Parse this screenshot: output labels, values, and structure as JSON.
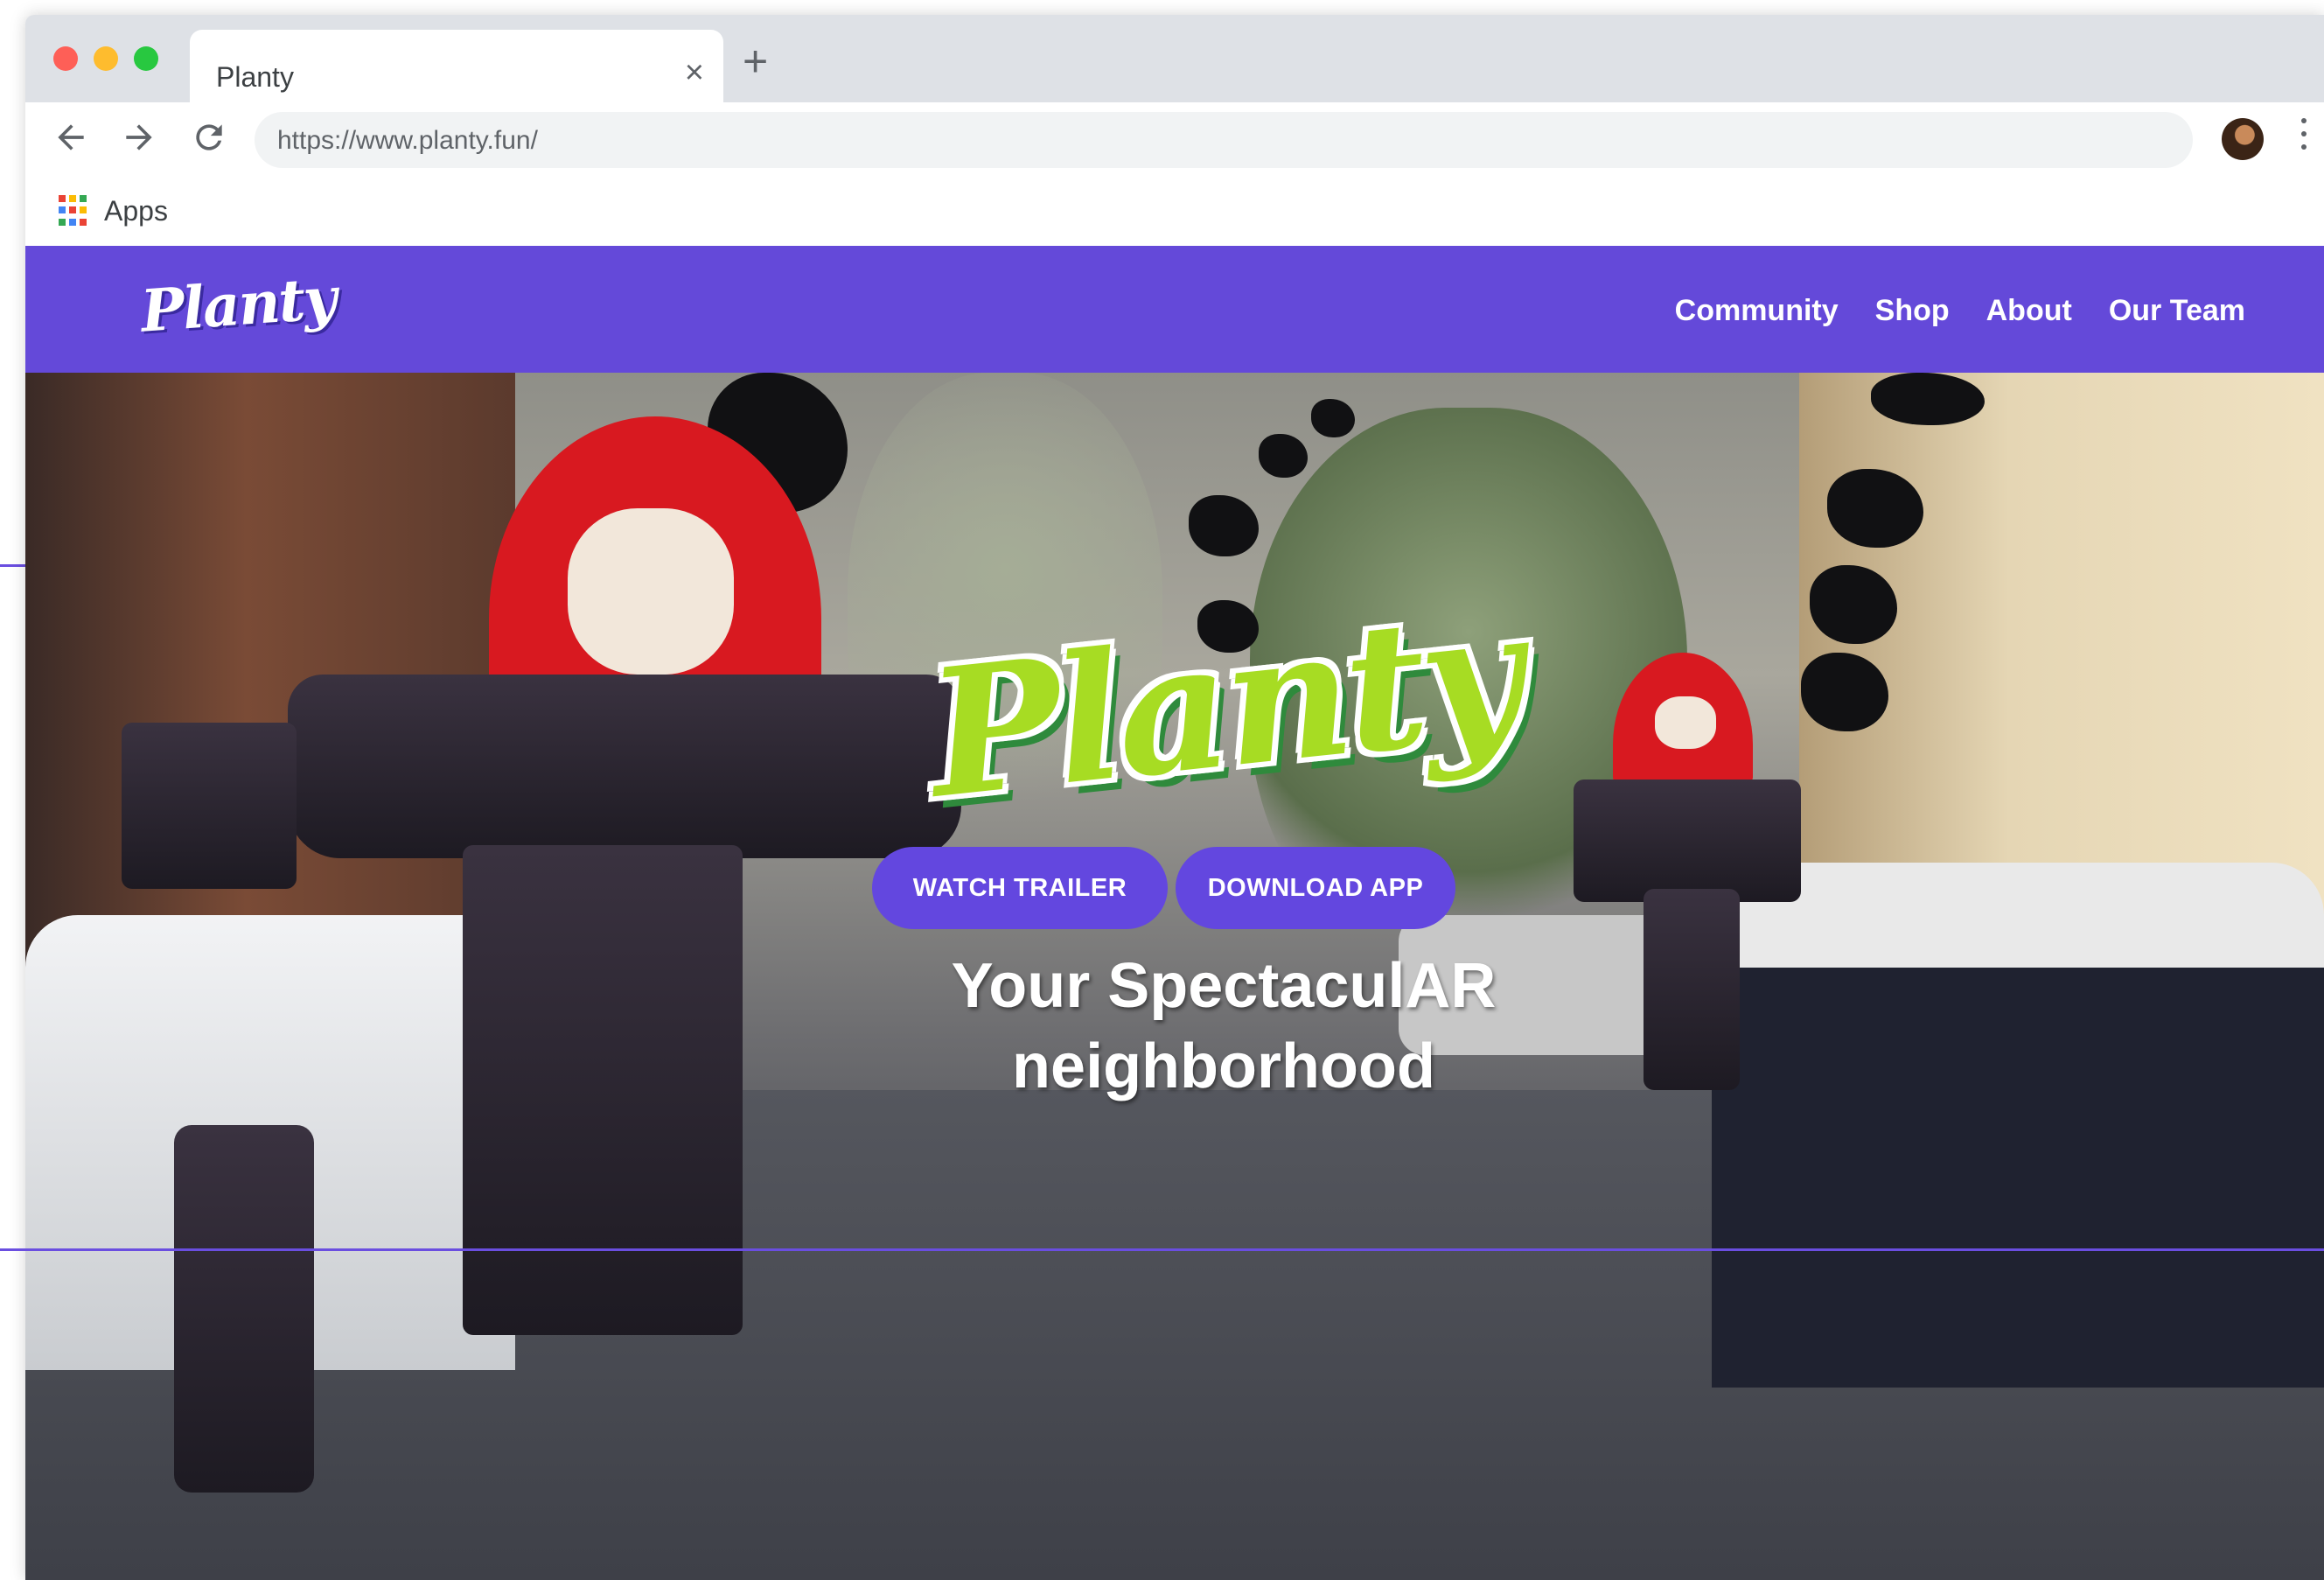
{
  "browser": {
    "tab_title": "Planty",
    "tab_close": "×",
    "new_tab": "+",
    "url": "https://www.planty.fun/",
    "bookmarks": [
      {
        "label": "Apps"
      }
    ]
  },
  "site": {
    "logo": "Planty",
    "nav": [
      {
        "label": "Community"
      },
      {
        "label": "Shop"
      },
      {
        "label": "About"
      },
      {
        "label": "Our Team"
      }
    ],
    "hero": {
      "logo": "Planty",
      "tagline_line1": "Your SpectaculAR",
      "tagline_line2": "neighborhood",
      "buttons": [
        {
          "label": "WATCH TRAILER"
        },
        {
          "label": "DOWNLOAD APP"
        }
      ]
    }
  },
  "colors": {
    "brand_purple": "#6449d9",
    "button_purple": "#6347df",
    "logo_green": "#a7dc23"
  }
}
